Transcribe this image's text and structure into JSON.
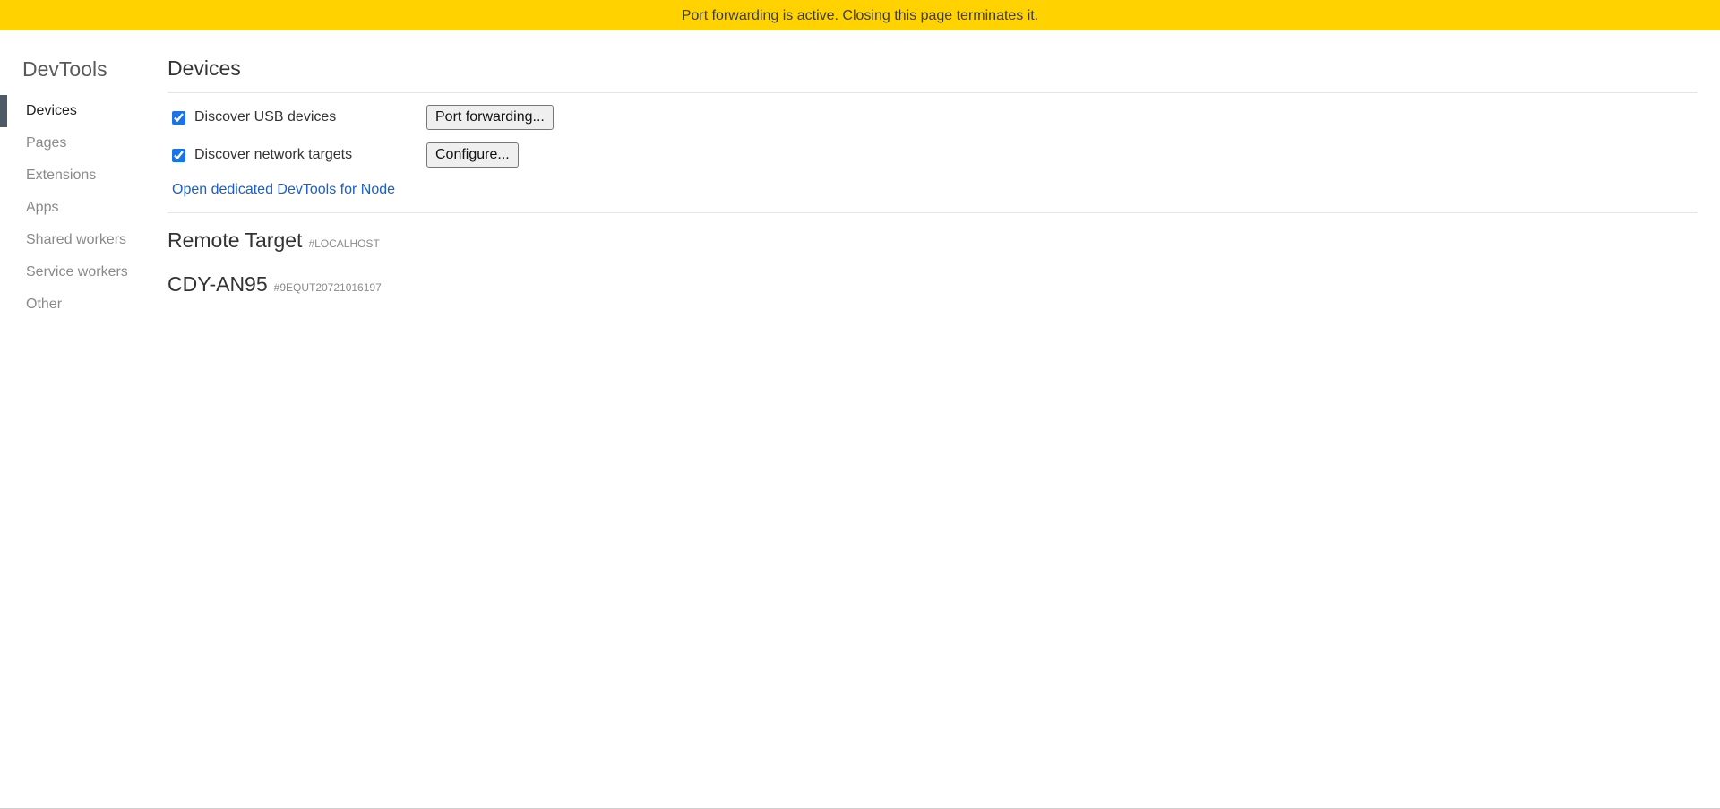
{
  "banner": {
    "text": "Port forwarding is active. Closing this page terminates it."
  },
  "sidebar": {
    "title": "DevTools",
    "items": [
      {
        "label": "Devices",
        "selected": true
      },
      {
        "label": "Pages"
      },
      {
        "label": "Extensions"
      },
      {
        "label": "Apps"
      },
      {
        "label": "Shared workers"
      },
      {
        "label": "Service workers"
      },
      {
        "label": "Other"
      }
    ]
  },
  "main": {
    "title": "Devices",
    "discover_usb": {
      "label": "Discover USB devices",
      "checked": true,
      "button": "Port forwarding..."
    },
    "discover_network": {
      "label": "Discover network targets",
      "checked": true,
      "button": "Configure..."
    },
    "node_link": "Open dedicated DevTools for Node",
    "targets": [
      {
        "name": "Remote Target",
        "id": "#LOCALHOST"
      },
      {
        "name": "CDY-AN95",
        "id": "#9EQUT20721016197"
      }
    ]
  },
  "colors": {
    "banner": "#ffd200",
    "selected_marker": "#4e5b67",
    "link": "#1a5fc8"
  }
}
